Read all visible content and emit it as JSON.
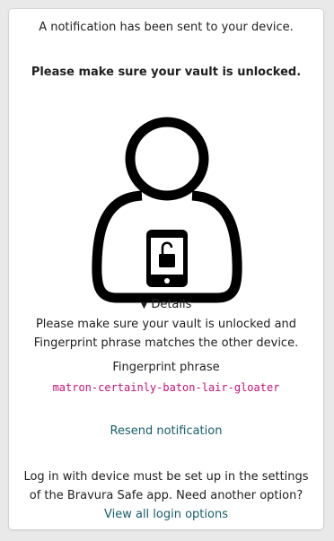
{
  "notification": {
    "sent_text": "A notification has been sent to your device.",
    "unlock_text": "Please make sure your vault is unlocked."
  },
  "illustration": {
    "icon": "user-with-unlocked-phone-icon"
  },
  "details": {
    "toggle_label": "Details",
    "toggle_icon": "triangle-down-icon",
    "description_line1": "Please make sure your vault is unlocked and",
    "description_line2": "Fingerprint phrase matches the other device.",
    "fingerprint_label": "Fingerprint phrase",
    "fingerprint_phrase": "matron-certainly-baton-lair-gloater"
  },
  "actions": {
    "resend_label": "Resend notification"
  },
  "help": {
    "line1": "Log in with device must be set up in the settings",
    "line2": "of the Bravura Safe app. Need another option?",
    "link_label": "View all login options"
  },
  "colors": {
    "link": "#175d69",
    "fingerprint": "#c01176"
  }
}
